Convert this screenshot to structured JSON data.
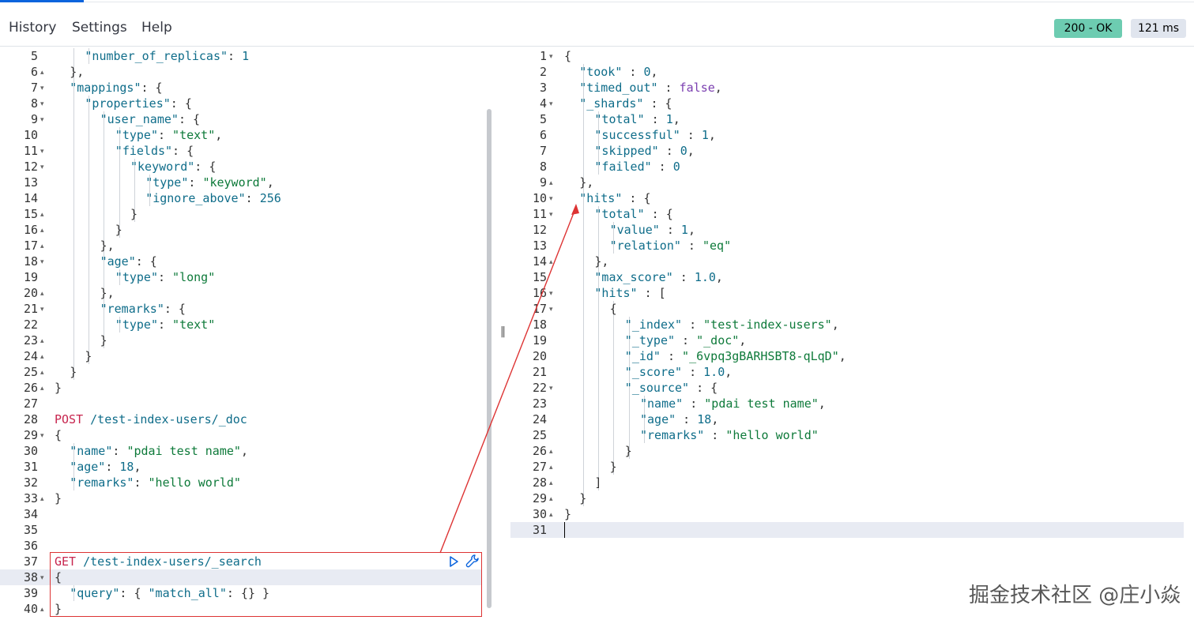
{
  "menu": {
    "history": "History",
    "settings": "Settings",
    "help": "Help"
  },
  "status": {
    "code": "200 - OK",
    "time": "121 ms",
    "color": "#6dccb1"
  },
  "watermark": "掘金技术社区 @庄小焱",
  "left_lines": [
    {
      "n": "5",
      "fold": "",
      "t": [
        [
          "k",
          "\"number_of_replicas\""
        ],
        [
          "p",
          ": "
        ],
        [
          "n",
          "1"
        ]
      ],
      "ind": 2
    },
    {
      "n": "6",
      "fold": "▴",
      "t": [
        [
          "p",
          "},"
        ]
      ],
      "ind": 1
    },
    {
      "n": "7",
      "fold": "▾",
      "t": [
        [
          "k",
          "\"mappings\""
        ],
        [
          "p",
          ": {"
        ]
      ],
      "ind": 1
    },
    {
      "n": "8",
      "fold": "▾",
      "t": [
        [
          "k",
          "\"properties\""
        ],
        [
          "p",
          ": {"
        ]
      ],
      "ind": 2
    },
    {
      "n": "9",
      "fold": "▾",
      "t": [
        [
          "k",
          "\"user_name\""
        ],
        [
          "p",
          ": {"
        ]
      ],
      "ind": 3
    },
    {
      "n": "10",
      "fold": "",
      "t": [
        [
          "k",
          "\"type\""
        ],
        [
          "p",
          ": "
        ],
        [
          "s",
          "\"text\""
        ],
        [
          "p",
          ","
        ]
      ],
      "ind": 4
    },
    {
      "n": "11",
      "fold": "▾",
      "t": [
        [
          "k",
          "\"fields\""
        ],
        [
          "p",
          ": {"
        ]
      ],
      "ind": 4
    },
    {
      "n": "12",
      "fold": "▾",
      "t": [
        [
          "k",
          "\"keyword\""
        ],
        [
          "p",
          ": {"
        ]
      ],
      "ind": 5
    },
    {
      "n": "13",
      "fold": "",
      "t": [
        [
          "k",
          "\"type\""
        ],
        [
          "p",
          ": "
        ],
        [
          "s",
          "\"keyword\""
        ],
        [
          "p",
          ","
        ]
      ],
      "ind": 6
    },
    {
      "n": "14",
      "fold": "",
      "t": [
        [
          "k",
          "\"ignore_above\""
        ],
        [
          "p",
          ": "
        ],
        [
          "n",
          "256"
        ]
      ],
      "ind": 6
    },
    {
      "n": "15",
      "fold": "▴",
      "t": [
        [
          "p",
          "}"
        ]
      ],
      "ind": 5
    },
    {
      "n": "16",
      "fold": "▴",
      "t": [
        [
          "p",
          "}"
        ]
      ],
      "ind": 4
    },
    {
      "n": "17",
      "fold": "▴",
      "t": [
        [
          "p",
          "},"
        ]
      ],
      "ind": 3
    },
    {
      "n": "18",
      "fold": "▾",
      "t": [
        [
          "k",
          "\"age\""
        ],
        [
          "p",
          ": {"
        ]
      ],
      "ind": 3
    },
    {
      "n": "19",
      "fold": "",
      "t": [
        [
          "k",
          "\"type\""
        ],
        [
          "p",
          ": "
        ],
        [
          "s",
          "\"long\""
        ]
      ],
      "ind": 4
    },
    {
      "n": "20",
      "fold": "▴",
      "t": [
        [
          "p",
          "},"
        ]
      ],
      "ind": 3
    },
    {
      "n": "21",
      "fold": "▾",
      "t": [
        [
          "k",
          "\"remarks\""
        ],
        [
          "p",
          ": {"
        ]
      ],
      "ind": 3
    },
    {
      "n": "22",
      "fold": "",
      "t": [
        [
          "k",
          "\"type\""
        ],
        [
          "p",
          ": "
        ],
        [
          "s",
          "\"text\""
        ]
      ],
      "ind": 4
    },
    {
      "n": "23",
      "fold": "▴",
      "t": [
        [
          "p",
          "}"
        ]
      ],
      "ind": 3
    },
    {
      "n": "24",
      "fold": "▴",
      "t": [
        [
          "p",
          "}"
        ]
      ],
      "ind": 2
    },
    {
      "n": "25",
      "fold": "▴",
      "t": [
        [
          "p",
          "}"
        ]
      ],
      "ind": 1
    },
    {
      "n": "26",
      "fold": "▴",
      "t": [
        [
          "p",
          "}"
        ]
      ],
      "ind": 0
    },
    {
      "n": "27",
      "fold": "",
      "t": [],
      "ind": 0
    },
    {
      "n": "28",
      "fold": "",
      "t": [
        [
          "m",
          "POST"
        ],
        [
          "p",
          " "
        ],
        [
          "u",
          "/test-index-users/_doc"
        ]
      ],
      "ind": 0
    },
    {
      "n": "29",
      "fold": "▾",
      "t": [
        [
          "p",
          "{"
        ]
      ],
      "ind": 0
    },
    {
      "n": "30",
      "fold": "",
      "t": [
        [
          "k",
          "\"name\""
        ],
        [
          "p",
          ": "
        ],
        [
          "s",
          "\"pdai test name\""
        ],
        [
          "p",
          ","
        ]
      ],
      "ind": 1
    },
    {
      "n": "31",
      "fold": "",
      "t": [
        [
          "k",
          "\"age\""
        ],
        [
          "p",
          ": "
        ],
        [
          "n",
          "18"
        ],
        [
          "p",
          ","
        ]
      ],
      "ind": 1
    },
    {
      "n": "32",
      "fold": "",
      "t": [
        [
          "k",
          "\"remarks\""
        ],
        [
          "p",
          ": "
        ],
        [
          "s",
          "\"hello world\""
        ]
      ],
      "ind": 1
    },
    {
      "n": "33",
      "fold": "▴",
      "t": [
        [
          "p",
          "}"
        ]
      ],
      "ind": 0
    },
    {
      "n": "34",
      "fold": "",
      "t": [],
      "ind": 0
    },
    {
      "n": "35",
      "fold": "",
      "t": [],
      "ind": 0
    },
    {
      "n": "36",
      "fold": "",
      "t": [],
      "ind": 0
    },
    {
      "n": "37",
      "fold": "",
      "t": [
        [
          "m",
          "GET"
        ],
        [
          "p",
          " "
        ],
        [
          "u",
          "/test-index-users/_search"
        ]
      ],
      "ind": 0
    },
    {
      "n": "38",
      "fold": "▾",
      "t": [
        [
          "p",
          "{"
        ]
      ],
      "ind": 0
    },
    {
      "n": "39",
      "fold": "",
      "t": [
        [
          "k",
          "\"query\""
        ],
        [
          "p",
          ": { "
        ],
        [
          "k",
          "\"match_all\""
        ],
        [
          "p",
          ": {} }"
        ]
      ],
      "ind": 1
    },
    {
      "n": "40",
      "fold": "▴",
      "t": [
        [
          "p",
          "}"
        ]
      ],
      "ind": 0
    }
  ],
  "right_lines": [
    {
      "n": "1",
      "fold": "▾",
      "t": [
        [
          "p",
          "{"
        ]
      ],
      "ind": 0
    },
    {
      "n": "2",
      "fold": "",
      "t": [
        [
          "k",
          "\"took\""
        ],
        [
          "p",
          " : "
        ],
        [
          "n",
          "0"
        ],
        [
          "p",
          ","
        ]
      ],
      "ind": 1
    },
    {
      "n": "3",
      "fold": "",
      "t": [
        [
          "k",
          "\"timed_out\""
        ],
        [
          "p",
          " : "
        ],
        [
          "b",
          "false"
        ],
        [
          "p",
          ","
        ]
      ],
      "ind": 1
    },
    {
      "n": "4",
      "fold": "▾",
      "t": [
        [
          "k",
          "\"_shards\""
        ],
        [
          "p",
          " : {"
        ]
      ],
      "ind": 1
    },
    {
      "n": "5",
      "fold": "",
      "t": [
        [
          "k",
          "\"total\""
        ],
        [
          "p",
          " : "
        ],
        [
          "n",
          "1"
        ],
        [
          "p",
          ","
        ]
      ],
      "ind": 2
    },
    {
      "n": "6",
      "fold": "",
      "t": [
        [
          "k",
          "\"successful\""
        ],
        [
          "p",
          " : "
        ],
        [
          "n",
          "1"
        ],
        [
          "p",
          ","
        ]
      ],
      "ind": 2
    },
    {
      "n": "7",
      "fold": "",
      "t": [
        [
          "k",
          "\"skipped\""
        ],
        [
          "p",
          " : "
        ],
        [
          "n",
          "0"
        ],
        [
          "p",
          ","
        ]
      ],
      "ind": 2
    },
    {
      "n": "8",
      "fold": "",
      "t": [
        [
          "k",
          "\"failed\""
        ],
        [
          "p",
          " : "
        ],
        [
          "n",
          "0"
        ]
      ],
      "ind": 2
    },
    {
      "n": "9",
      "fold": "▴",
      "t": [
        [
          "p",
          "},"
        ]
      ],
      "ind": 1
    },
    {
      "n": "10",
      "fold": "▾",
      "t": [
        [
          "k",
          "\"hits\""
        ],
        [
          "p",
          " : {"
        ]
      ],
      "ind": 1
    },
    {
      "n": "11",
      "fold": "▾",
      "t": [
        [
          "k",
          "\"total\""
        ],
        [
          "p",
          " : {"
        ]
      ],
      "ind": 2
    },
    {
      "n": "12",
      "fold": "",
      "t": [
        [
          "k",
          "\"value\""
        ],
        [
          "p",
          " : "
        ],
        [
          "n",
          "1"
        ],
        [
          "p",
          ","
        ]
      ],
      "ind": 3
    },
    {
      "n": "13",
      "fold": "",
      "t": [
        [
          "k",
          "\"relation\""
        ],
        [
          "p",
          " : "
        ],
        [
          "s",
          "\"eq\""
        ]
      ],
      "ind": 3
    },
    {
      "n": "14",
      "fold": "▴",
      "t": [
        [
          "p",
          "},"
        ]
      ],
      "ind": 2
    },
    {
      "n": "15",
      "fold": "",
      "t": [
        [
          "k",
          "\"max_score\""
        ],
        [
          "p",
          " : "
        ],
        [
          "n",
          "1.0"
        ],
        [
          "p",
          ","
        ]
      ],
      "ind": 2
    },
    {
      "n": "16",
      "fold": "▾",
      "t": [
        [
          "k",
          "\"hits\""
        ],
        [
          "p",
          " : ["
        ]
      ],
      "ind": 2
    },
    {
      "n": "17",
      "fold": "▾",
      "t": [
        [
          "p",
          "{"
        ]
      ],
      "ind": 3
    },
    {
      "n": "18",
      "fold": "",
      "t": [
        [
          "k",
          "\"_index\""
        ],
        [
          "p",
          " : "
        ],
        [
          "s",
          "\"test-index-users\""
        ],
        [
          "p",
          ","
        ]
      ],
      "ind": 4
    },
    {
      "n": "19",
      "fold": "",
      "t": [
        [
          "k",
          "\"_type\""
        ],
        [
          "p",
          " : "
        ],
        [
          "s",
          "\"_doc\""
        ],
        [
          "p",
          ","
        ]
      ],
      "ind": 4
    },
    {
      "n": "20",
      "fold": "",
      "t": [
        [
          "k",
          "\"_id\""
        ],
        [
          "p",
          " : "
        ],
        [
          "s",
          "\"_6vpq3gBARHSBT8-qLqD\""
        ],
        [
          "p",
          ","
        ]
      ],
      "ind": 4
    },
    {
      "n": "21",
      "fold": "",
      "t": [
        [
          "k",
          "\"_score\""
        ],
        [
          "p",
          " : "
        ],
        [
          "n",
          "1.0"
        ],
        [
          "p",
          ","
        ]
      ],
      "ind": 4
    },
    {
      "n": "22",
      "fold": "▾",
      "t": [
        [
          "k",
          "\"_source\""
        ],
        [
          "p",
          " : {"
        ]
      ],
      "ind": 4
    },
    {
      "n": "23",
      "fold": "",
      "t": [
        [
          "k",
          "\"name\""
        ],
        [
          "p",
          " : "
        ],
        [
          "s",
          "\"pdai test name\""
        ],
        [
          "p",
          ","
        ]
      ],
      "ind": 5
    },
    {
      "n": "24",
      "fold": "",
      "t": [
        [
          "k",
          "\"age\""
        ],
        [
          "p",
          " : "
        ],
        [
          "n",
          "18"
        ],
        [
          "p",
          ","
        ]
      ],
      "ind": 5
    },
    {
      "n": "25",
      "fold": "",
      "t": [
        [
          "k",
          "\"remarks\""
        ],
        [
          "p",
          " : "
        ],
        [
          "s",
          "\"hello world\""
        ]
      ],
      "ind": 5
    },
    {
      "n": "26",
      "fold": "▴",
      "t": [
        [
          "p",
          "}"
        ]
      ],
      "ind": 4
    },
    {
      "n": "27",
      "fold": "▴",
      "t": [
        [
          "p",
          "}"
        ]
      ],
      "ind": 3
    },
    {
      "n": "28",
      "fold": "▴",
      "t": [
        [
          "p",
          "]"
        ]
      ],
      "ind": 2
    },
    {
      "n": "29",
      "fold": "▴",
      "t": [
        [
          "p",
          "}"
        ]
      ],
      "ind": 1
    },
    {
      "n": "30",
      "fold": "▴",
      "t": [
        [
          "p",
          "}"
        ]
      ],
      "ind": 0
    },
    {
      "n": "31",
      "fold": "",
      "t": [],
      "ind": 0
    }
  ]
}
